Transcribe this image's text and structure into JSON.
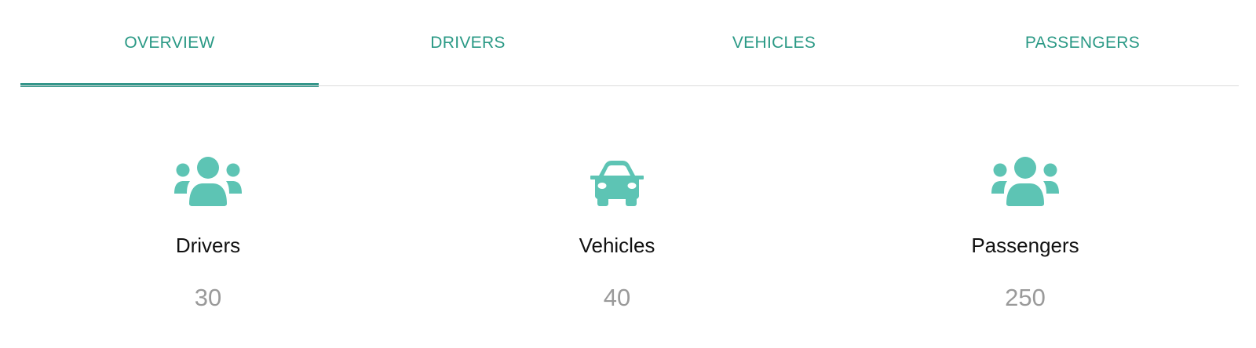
{
  "colors": {
    "accent": "#2a9985",
    "accent_dark": "#34968a",
    "icon": "#5dc4b4",
    "muted": "#9a9a9a"
  },
  "tabs": [
    {
      "label": "OVERVIEW",
      "active": true
    },
    {
      "label": "DRIVERS",
      "active": false
    },
    {
      "label": "VEHICLES",
      "active": false
    },
    {
      "label": "PASSENGERS",
      "active": false
    }
  ],
  "stats": [
    {
      "icon": "users-icon",
      "label": "Drivers",
      "value": "30"
    },
    {
      "icon": "car-icon",
      "label": "Vehicles",
      "value": "40"
    },
    {
      "icon": "users-icon",
      "label": "Passengers",
      "value": "250"
    }
  ]
}
